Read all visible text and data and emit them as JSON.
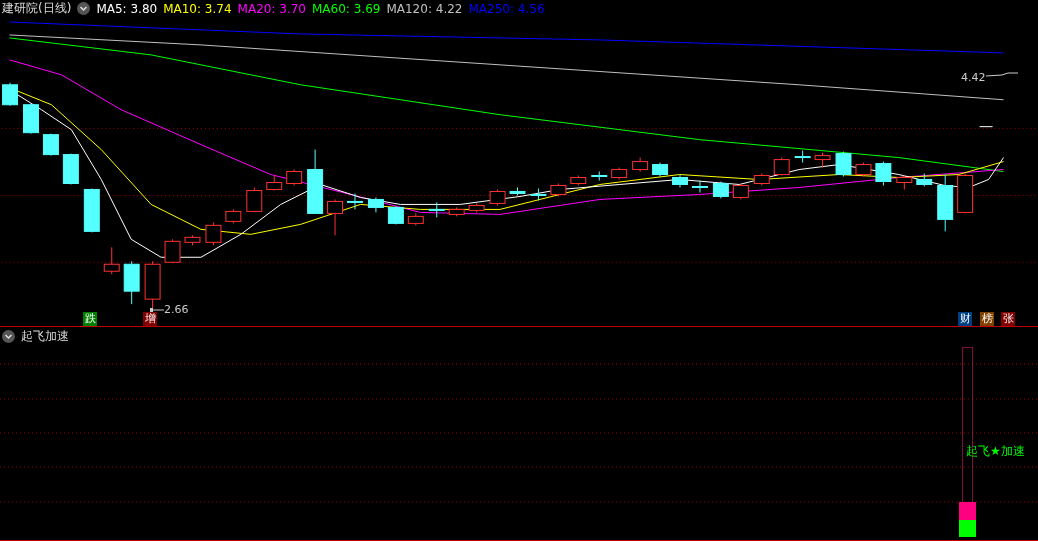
{
  "main_panel": {
    "title": "建研院(日线)",
    "indicators": [
      {
        "label": "MA5: 3.80",
        "color": "#ffffff"
      },
      {
        "label": "MA10: 3.74",
        "color": "#ffff00"
      },
      {
        "label": "MA20: 3.70",
        "color": "#ff00ff"
      },
      {
        "label": "MA60: 3.69",
        "color": "#00ff00"
      },
      {
        "label": "MA120: 4.22",
        "color": "#c0c0c0"
      },
      {
        "label": "MA250: 4.56",
        "color": "#0000ff"
      }
    ],
    "high_label": "4.42",
    "low_label": "2.66",
    "badges": [
      {
        "text": "跌",
        "color": "#008000"
      },
      {
        "text": "增",
        "color": "#800000"
      },
      {
        "text": "财",
        "color": "#004080"
      },
      {
        "text": "榜",
        "color": "#804000"
      },
      {
        "text": "张",
        "color": "#800000"
      }
    ]
  },
  "sub_panel": {
    "title": "起飞加速",
    "signal_text": "起飞★加速"
  }
}
